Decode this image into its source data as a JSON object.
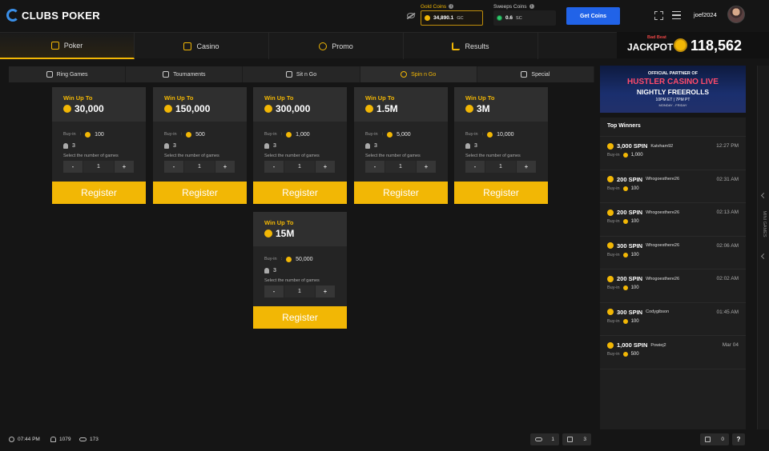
{
  "brand": {
    "name": "CLUBS POKER"
  },
  "wallet": {
    "gold": {
      "label": "Gold Coins",
      "value": "34,890.1",
      "unit": "GC"
    },
    "sweeps": {
      "label": "Sweeps Coins",
      "value": "0.6",
      "unit": "SC"
    },
    "get_coins_label": "Get Coins"
  },
  "user": {
    "name": "joef2024"
  },
  "nav": {
    "tabs": [
      {
        "label": "Poker",
        "active": true
      },
      {
        "label": "Casino",
        "active": false
      },
      {
        "label": "Promo",
        "active": false
      },
      {
        "label": "Results",
        "active": false
      }
    ]
  },
  "jackpot": {
    "sub": "Bad Beat",
    "label": "JACKPOT",
    "amount": "118,562"
  },
  "subtabs": [
    {
      "label": "Ring Games",
      "active": false
    },
    {
      "label": "Tournaments",
      "active": false
    },
    {
      "label": "Sit n Go",
      "active": false
    },
    {
      "label": "Spin n Go",
      "active": true
    },
    {
      "label": "Special",
      "active": false
    }
  ],
  "cards": [
    {
      "win_label": "Win Up To",
      "win_amount": "30,000",
      "buyin_label": "Buy-in",
      "buyin": "100",
      "players": "3",
      "select_label": "Select the number of games",
      "minus": "-",
      "count": "1",
      "plus": "+",
      "register": "Register"
    },
    {
      "win_label": "Win Up To",
      "win_amount": "150,000",
      "buyin_label": "Buy-in",
      "buyin": "500",
      "players": "3",
      "select_label": "Select the number of games",
      "minus": "-",
      "count": "1",
      "plus": "+",
      "register": "Register"
    },
    {
      "win_label": "Win Up To",
      "win_amount": "300,000",
      "buyin_label": "Buy-in",
      "buyin": "1,000",
      "players": "3",
      "select_label": "Select the number of games",
      "minus": "-",
      "count": "1",
      "plus": "+",
      "register": "Register"
    },
    {
      "win_label": "Win Up To",
      "win_amount": "1.5M",
      "buyin_label": "Buy-in",
      "buyin": "5,000",
      "players": "3",
      "select_label": "Select the number of games",
      "minus": "-",
      "count": "1",
      "plus": "+",
      "register": "Register"
    },
    {
      "win_label": "Win Up To",
      "win_amount": "3M",
      "buyin_label": "Buy-in",
      "buyin": "10,000",
      "players": "3",
      "select_label": "Select the number of games",
      "minus": "-",
      "count": "1",
      "plus": "+",
      "register": "Register"
    },
    {
      "win_label": "Win Up To",
      "win_amount": "15M",
      "buyin_label": "Buy-in",
      "buyin": "50,000",
      "players": "3",
      "select_label": "Select the number of games",
      "minus": "-",
      "count": "1",
      "plus": "+",
      "register": "Register"
    }
  ],
  "banner": {
    "line1": "OFFICIAL PARTNER OF",
    "line2": "HUSTLER CASINO LIVE",
    "line3": "NIGHTLY FREEROLLS",
    "line4": "10PM ET | 7PM PT",
    "line5": "MONDAY - FRIDAY"
  },
  "top_winners": {
    "title": "Top Winners",
    "buyin_label": "Buy-in",
    "rows": [
      {
        "prize": "3,000 SPIN",
        "name": "Katvham92",
        "time": "12:27 PM",
        "buyin": "1,000"
      },
      {
        "prize": "200 SPIN",
        "name": "Whogoesthere26",
        "time": "02:31 AM",
        "buyin": "100"
      },
      {
        "prize": "200 SPIN",
        "name": "Whogoesthere26",
        "time": "02:13 AM",
        "buyin": "100"
      },
      {
        "prize": "300 SPIN",
        "name": "Whogoesthere26",
        "time": "02:06 AM",
        "buyin": "100"
      },
      {
        "prize": "200 SPIN",
        "name": "Whogoesthere26",
        "time": "02:02 AM",
        "buyin": "100"
      },
      {
        "prize": "300 SPIN",
        "name": "Codygibson",
        "time": "01:45 AM",
        "buyin": "100"
      },
      {
        "prize": "1,000 SPIN",
        "name": "Powiej2",
        "time": "Mar 04",
        "buyin": "500"
      }
    ]
  },
  "side_rail": {
    "label": "MINI GAMES"
  },
  "footer": {
    "time": "07:44 PM",
    "players": "1079",
    "tables": "173",
    "open_tables": "1",
    "tournaments": "3",
    "chat": "0",
    "help": "?"
  },
  "colors": {
    "accent": "#f2b705",
    "primary_button": "#2163e8",
    "background": "#151515"
  }
}
